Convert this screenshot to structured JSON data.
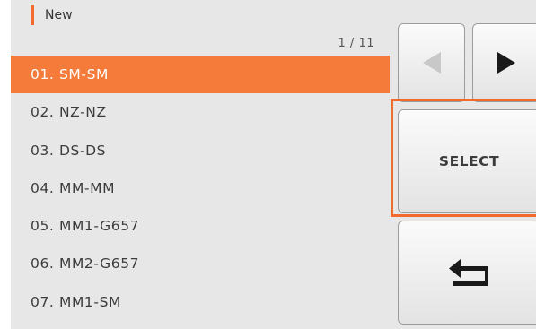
{
  "header": {
    "title": "New"
  },
  "list": {
    "page_counter": "1 / 11",
    "items": [
      {
        "label": "01. SM-SM"
      },
      {
        "label": "02. NZ-NZ"
      },
      {
        "label": "03. DS-DS"
      },
      {
        "label": "04. MM-MM"
      },
      {
        "label": "05. MM1-G657"
      },
      {
        "label": "06. MM2-G657"
      },
      {
        "label": "07. MM1-SM"
      }
    ],
    "selected_index": 0
  },
  "buttons": {
    "prev_icon": "left-triangle-icon",
    "next_icon": "right-triangle-icon",
    "select_label": "SELECT",
    "back_icon": "return-arrow-icon"
  },
  "colors": {
    "accent": "#f26a2e",
    "selected_row": "#f47b3a",
    "background": "#e7e7e7"
  }
}
